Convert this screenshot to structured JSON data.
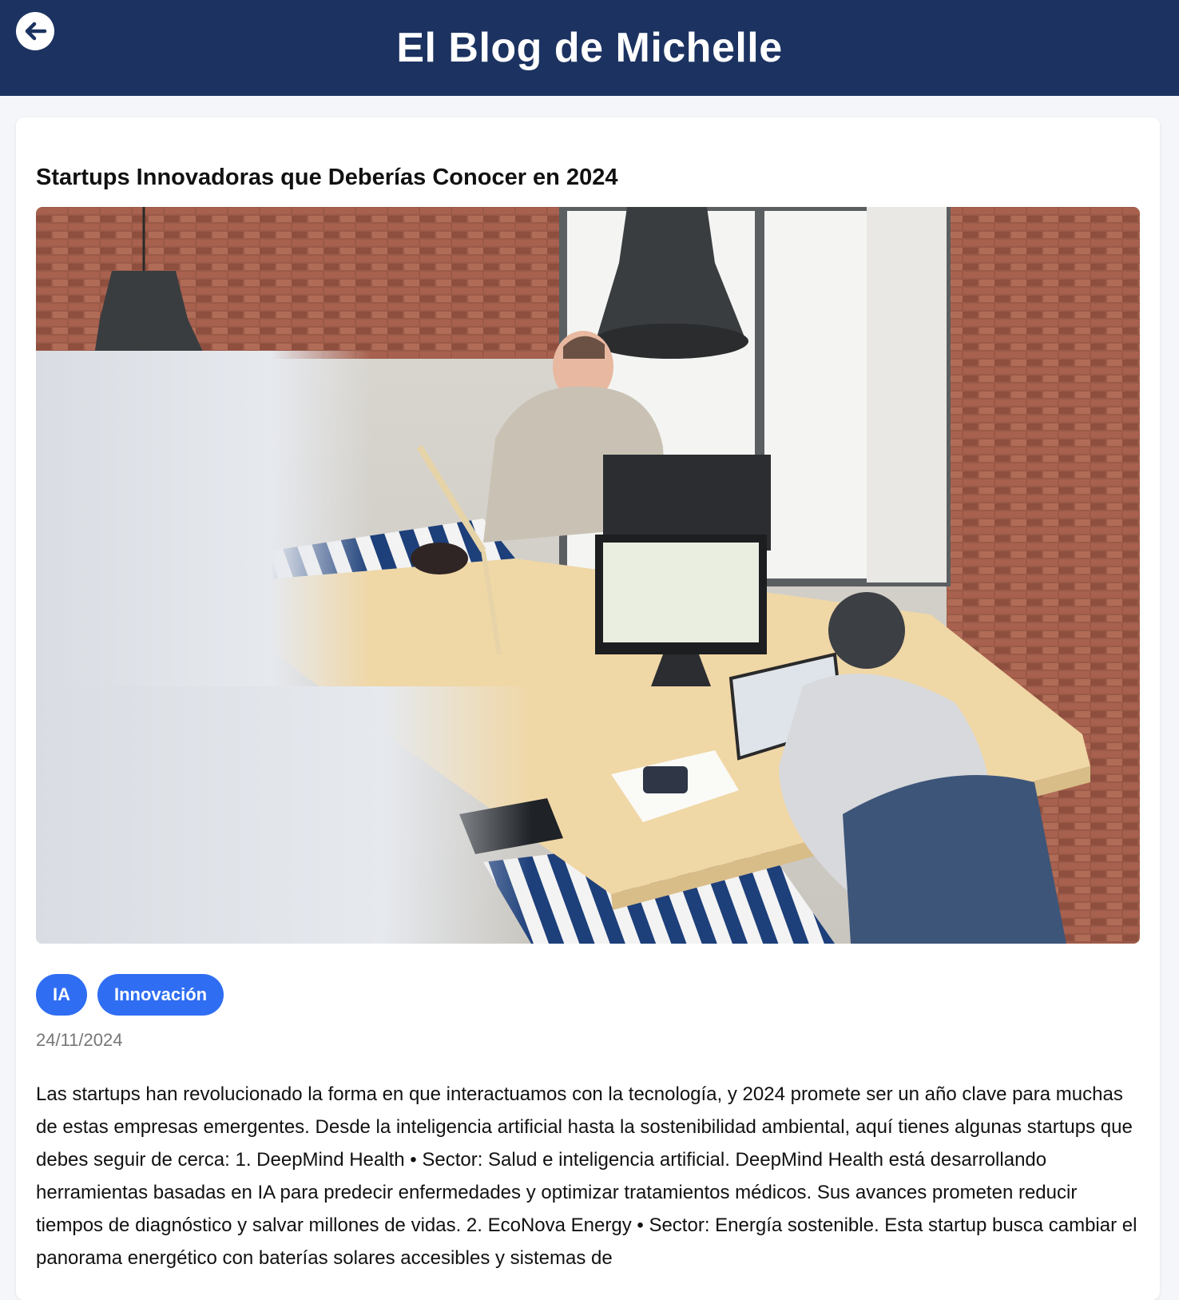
{
  "header": {
    "site_title": "El Blog de Michelle",
    "back_icon": "arrow-left-icon"
  },
  "post": {
    "title": "Startups Innovadoras que Deberías Conocer en 2024",
    "image_alt": "",
    "tags": [
      {
        "label": "IA"
      },
      {
        "label": "Innovación"
      }
    ],
    "date": "24/11/2024",
    "body": "Las startups han revolucionado la forma en que interactuamos con la tecnología, y 2024 promete ser un año clave para muchas de estas empresas emergentes. Desde la inteligencia artificial hasta la sostenibilidad ambiental, aquí tienes algunas startups que debes seguir de cerca: 1. DeepMind Health • Sector: Salud e inteligencia artificial. DeepMind Health está desarrollando herramientas basadas en IA para predecir enfermedades y optimizar tratamientos médicos. Sus avances prometen reducir tiempos de diagnóstico y salvar millones de vidas. 2. EcoNova Energy • Sector: Energía sostenible. Esta startup busca cambiar el panorama energético con baterías solares accesibles y sistemas de"
  },
  "colors": {
    "header_bg": "#1c3361",
    "tag_bg": "#2f6ef2",
    "date_text": "#777777"
  }
}
